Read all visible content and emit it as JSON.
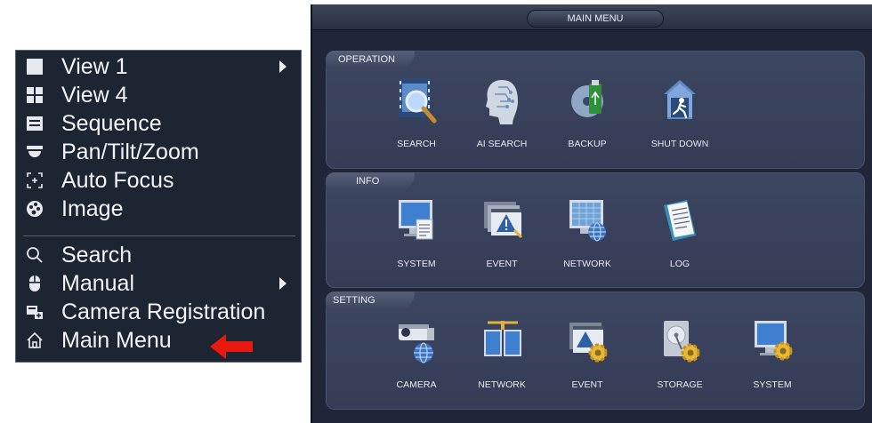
{
  "context_menu": {
    "items": [
      {
        "label": "View 1",
        "icon": "square-icon",
        "submenu": true
      },
      {
        "label": "View 4",
        "icon": "grid-icon",
        "submenu": false
      },
      {
        "label": "Sequence",
        "icon": "sequence-icon",
        "submenu": false
      },
      {
        "label": "Pan/Tilt/Zoom",
        "icon": "ptz-icon",
        "submenu": false
      },
      {
        "label": "Auto Focus",
        "icon": "focus-icon",
        "submenu": false
      },
      {
        "label": "Image",
        "icon": "image-icon",
        "submenu": false
      },
      {
        "label": "Search",
        "icon": "search-icon",
        "submenu": false
      },
      {
        "label": "Manual",
        "icon": "mouse-icon",
        "submenu": true
      },
      {
        "label": "Camera Registration",
        "icon": "camera-registration-icon",
        "submenu": false
      },
      {
        "label": "Main Menu",
        "icon": "home-icon",
        "submenu": false
      }
    ],
    "highlight_color": "#e8190f"
  },
  "main_menu": {
    "title": "MAIN MENU",
    "sections": {
      "operation": {
        "title": "OPERATION",
        "items": [
          "SEARCH",
          "AI SEARCH",
          "BACKUP",
          "SHUT DOWN"
        ]
      },
      "info": {
        "title": "INFO",
        "items": [
          "SYSTEM",
          "EVENT",
          "NETWORK",
          "LOG"
        ]
      },
      "setting": {
        "title": "SETTING",
        "items": [
          "CAMERA",
          "NETWORK",
          "EVENT",
          "STORAGE",
          "SYSTEM"
        ]
      }
    }
  }
}
